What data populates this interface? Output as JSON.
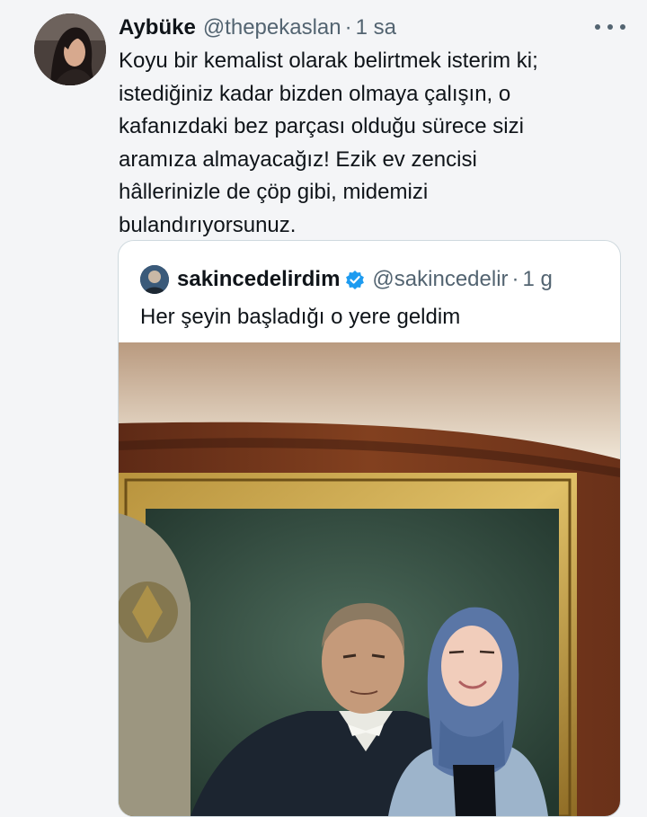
{
  "tweet": {
    "author_name": "Aybüke",
    "author_handle": "@thepekaslan",
    "separator": "·",
    "timestamp": "1 sa",
    "more_icon": "more-dots-icon",
    "lines": [
      "Koyu bir kemalist olarak belirtmek isterim ki;",
      "istediğiniz kadar bizden olmaya çalışın, o",
      "kafanızdaki bez parçası olduğu sürece sizi",
      "aramıza almayacağız! Ezik ev zencisi",
      "hâllerinizle de çöp gibi, midemizi",
      "bulandırıyorsunuz."
    ]
  },
  "quoted_tweet": {
    "author_name": "sakincedelirdim",
    "verified_icon": "verified-badge-icon",
    "author_handle": "@sakincedelir",
    "separator": "·",
    "timestamp": "1 g",
    "text": "Her şeyin başladığı o yere geldim"
  },
  "colors": {
    "text": "#0f1419",
    "secondary": "#536471",
    "verified": "#1d9bf0",
    "border": "#cfd9de",
    "background": "#f4f5f7"
  }
}
